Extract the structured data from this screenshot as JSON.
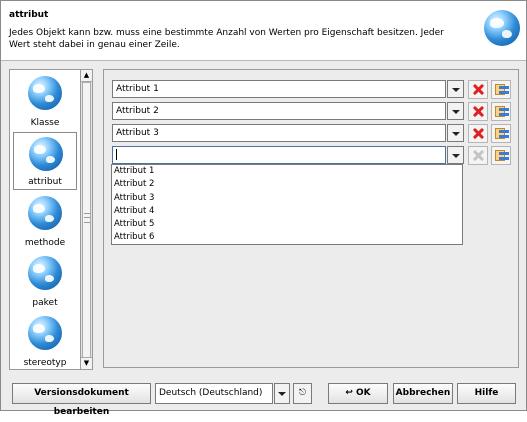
{
  "header": {
    "title": "attribut",
    "description": "Jedes Objekt kann bzw. muss eine bestimmte Anzahl von Werten pro Eigenschaft besitzen. Jeder Wert steht dabei in genau einer Zeile."
  },
  "sidebar": {
    "items": [
      {
        "label": "Klasse",
        "selected": false
      },
      {
        "label": "attribut",
        "selected": true
      },
      {
        "label": "methode",
        "selected": false
      },
      {
        "label": "paket",
        "selected": false
      },
      {
        "label": "stereotyp",
        "selected": false
      }
    ]
  },
  "rows": [
    {
      "value": "Attribut 1"
    },
    {
      "value": "Attribut 2"
    },
    {
      "value": "Attribut 3"
    },
    {
      "value": ""
    }
  ],
  "dropdown_options": [
    "Attribut 1",
    "Attribut 2",
    "Attribut 3",
    "Attribut 4",
    "Attribut 5",
    "Attribut 6"
  ],
  "footer": {
    "version_button": "Versionsdokument bearbeiten",
    "language": "Deutsch (Deutschland)",
    "ok_label": "OK",
    "cancel_label": "Abbrechen",
    "help_label": "Hilfe"
  },
  "icons": {
    "header": "globe-icon",
    "sidebar": "globe-icon",
    "delete": "red-x-icon",
    "pick": "value-list-icon",
    "ok": "return-arrow-icon",
    "tool": "edit-icon"
  },
  "colors": {
    "delete": "#e02020",
    "accent": "#3b7bd6"
  }
}
